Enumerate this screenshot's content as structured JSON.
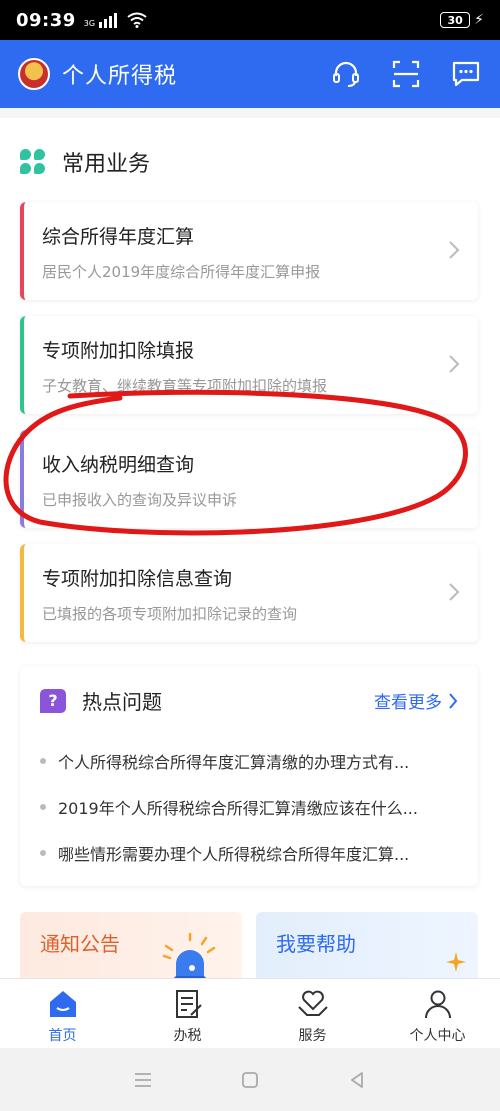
{
  "status": {
    "time": "09:39",
    "network": "3G",
    "battery": "30"
  },
  "header": {
    "title": "个人所得税",
    "icons": [
      "tax-emblem-logo",
      "headset-icon",
      "scan-icon",
      "message-icon"
    ]
  },
  "section": {
    "title": "常用业务"
  },
  "services": [
    {
      "title": "综合所得年度汇算",
      "subtitle": "居民个人2019年度综合所得年度汇算申报",
      "accent": "#e8445a"
    },
    {
      "title": "专项附加扣除填报",
      "subtitle": "子女教育、继续教育等专项附加扣除的填报",
      "accent": "#2ec48a"
    },
    {
      "title": "收入纳税明细查询",
      "subtitle": "已申报收入的查询及异议申诉",
      "accent": "#8a7be0"
    },
    {
      "title": "专项附加扣除信息查询",
      "subtitle": "已填报的各项专项附加扣除记录的查询",
      "accent": "#f5b942"
    }
  ],
  "hot": {
    "title": "热点问题",
    "more": "查看更多",
    "items": [
      "个人所得税综合所得年度汇算清缴的办理方式有...",
      "2019年个人所得税综合所得汇算清缴应该在什么...",
      "哪些情形需要办理个人所得税综合所得年度汇算..."
    ]
  },
  "tiles": {
    "notice": "通知公告",
    "help": "我要帮助"
  },
  "tabs": [
    {
      "label": "首页",
      "icon": "home-icon",
      "active": true
    },
    {
      "label": "办税",
      "icon": "form-icon",
      "active": false
    },
    {
      "label": "服务",
      "icon": "heart-hand-icon",
      "active": false
    },
    {
      "label": "个人中心",
      "icon": "user-icon",
      "active": false
    }
  ],
  "colors": {
    "primary": "#2e6bf0",
    "annotation": "#e01818"
  }
}
